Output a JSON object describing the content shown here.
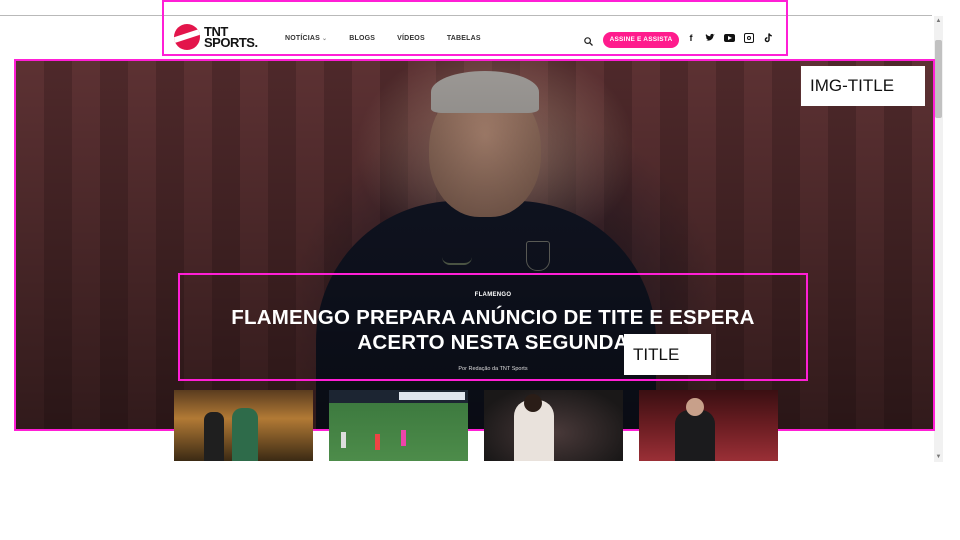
{
  "header": {
    "logo": {
      "line1": "TNT",
      "line2": "SPORTS."
    },
    "nav": [
      {
        "label": "NOTÍCIAS",
        "dropdown": true
      },
      {
        "label": "BLOGS"
      },
      {
        "label": "VÍDEOS"
      },
      {
        "label": "TABELAS"
      }
    ],
    "cta_label": "ASSINE E ASSISTA",
    "socials": [
      "facebook-icon",
      "twitter-icon",
      "youtube-icon",
      "instagram-icon",
      "tiktok-icon"
    ]
  },
  "hero": {
    "img_title_label": "IMG-TITLE",
    "kicker": "FLAMENGO",
    "headline_line1": "FLAMENGO PREPARA ANÚNCIO DE TITE E ESPERA",
    "headline_line2": "ACERTO NESTA SEGUNDA",
    "byline": "Por Redação da TNT Sports",
    "title_label": "TITLE"
  },
  "colors": {
    "accent": "#ff1b8d",
    "annotation": "#ff1fd6",
    "logo_red": "#e3154b"
  }
}
